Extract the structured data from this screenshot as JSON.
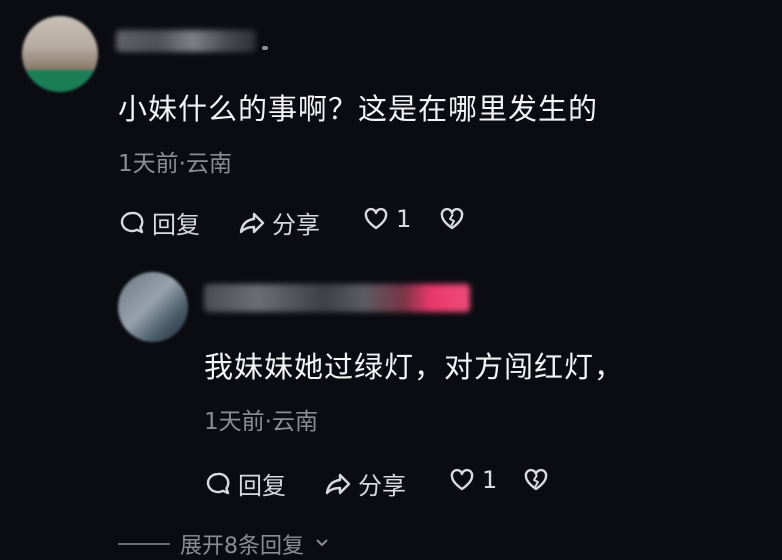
{
  "comments": [
    {
      "text": "小妹什么的事啊？这是在哪里发生的",
      "meta": "1天前·云南",
      "reply_label": "回复",
      "share_label": "分享",
      "like_count": "1"
    },
    {
      "text": "我妹妹她过绿灯，对方闯红灯，",
      "meta": "1天前·云南",
      "reply_label": "回复",
      "share_label": "分享",
      "like_count": "1"
    }
  ],
  "expand_replies_label": "展开8条回复",
  "icons": {
    "reply": "comment-bubble-icon",
    "share": "share-arrow-icon",
    "like": "heart-icon",
    "dislike": "broken-heart-icon",
    "expand": "chevron-down-icon"
  },
  "colors": {
    "background": "#0b0c12",
    "text_primary": "#f4f4f6",
    "text_secondary": "#8c8d94"
  }
}
